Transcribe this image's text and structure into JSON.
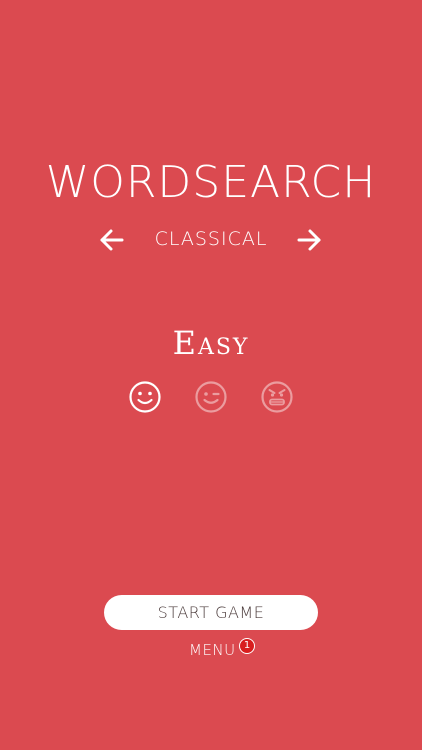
{
  "app": {
    "title": "WORDSEARCH"
  },
  "mode_selector": {
    "current_mode": "CLASSICAL",
    "prev_icon": "arrow-left-icon",
    "next_icon": "arrow-right-icon"
  },
  "difficulty": {
    "label": "Easy",
    "levels": [
      {
        "icon": "smiley-face-icon",
        "selected": true
      },
      {
        "icon": "winking-face-icon",
        "selected": false
      },
      {
        "icon": "angry-face-icon",
        "selected": false
      }
    ]
  },
  "actions": {
    "start_label": "START GAME",
    "menu_label": "MENU",
    "menu_badge_count": "1"
  },
  "colors": {
    "background": "#db4a50",
    "foreground": "#ffffff",
    "badge": "#d81e1e",
    "button_text": "#4a3a3a"
  }
}
